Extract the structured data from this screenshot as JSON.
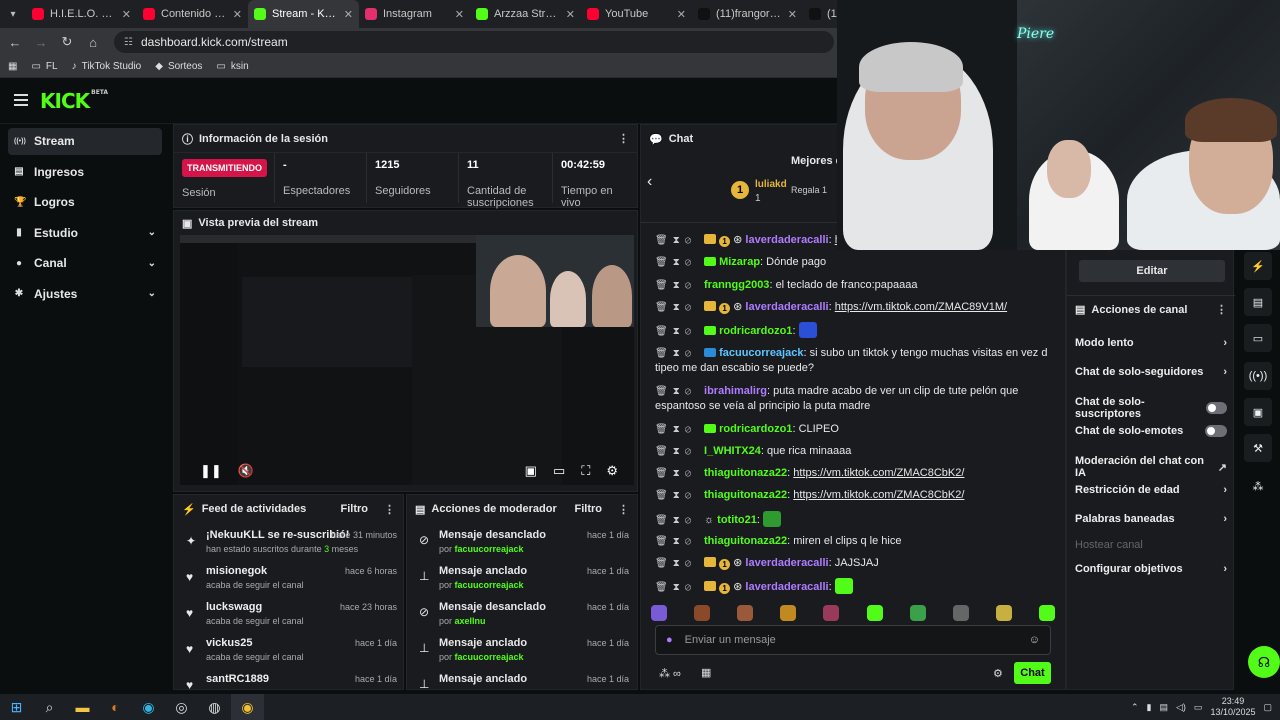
{
  "browser": {
    "tabs": [
      {
        "title": "H.I.E.L.O. - Yo",
        "color": "#ff0033",
        "active": false
      },
      {
        "title": "Contenido del can",
        "color": "#ff0033",
        "active": false
      },
      {
        "title": "Stream - Kick Das",
        "color": "#53fc18",
        "active": true
      },
      {
        "title": "Instagram",
        "color": "#e1306c",
        "active": false
      },
      {
        "title": "Arzzaa Stream - K",
        "color": "#53fc18",
        "active": false
      },
      {
        "title": "YouTube",
        "color": "#ff0033",
        "active": false
      },
      {
        "title": "(11)frangorini (@",
        "color": "#111111",
        "active": false
      },
      {
        "title": "(11",
        "color": "#111111",
        "active": false
      }
    ],
    "url": "dashboard.kick.com/stream",
    "bookmarks": [
      "FL",
      "TikTok Studio",
      "Sorteos",
      "ksin"
    ]
  },
  "header": {
    "logo": "KICK",
    "logo_tag": "BETA"
  },
  "sidebar": {
    "items": [
      {
        "label": "Stream",
        "icon": "live-icon",
        "glyph": "((•))",
        "active": true,
        "chevron": false
      },
      {
        "label": "Ingresos",
        "icon": "list-icon",
        "glyph": "▤",
        "active": false,
        "chevron": false
      },
      {
        "label": "Logros",
        "icon": "trophy-icon",
        "glyph": "🏆",
        "active": false,
        "chevron": false
      },
      {
        "label": "Estudio",
        "icon": "book-icon",
        "glyph": "▮",
        "active": false,
        "chevron": true
      },
      {
        "label": "Canal",
        "icon": "user-icon",
        "glyph": "●",
        "active": false,
        "chevron": true
      },
      {
        "label": "Ajustes",
        "icon": "gear-icon",
        "glyph": "✱",
        "active": false,
        "chevron": true
      }
    ]
  },
  "session": {
    "title": "Información de la sesión",
    "live_badge": "TRANSMITIENDO",
    "live_label": "Sesión",
    "stats": [
      {
        "value": "-",
        "label": "Espectadores"
      },
      {
        "value": "1215",
        "label": "Seguidores"
      },
      {
        "value": "11",
        "label": "Cantidad de suscripciones"
      },
      {
        "value": "00:42:59",
        "label": "Tiempo en vivo"
      }
    ]
  },
  "preview": {
    "title": "Vista previa del stream"
  },
  "feed": {
    "title": "Feed de actividades",
    "filter": "Filtro",
    "items": [
      {
        "name": "¡NekuuKLL se re-suscribió!",
        "sub_pre": "han estado suscritos durante ",
        "sub_num": "3",
        "sub_post": " meses",
        "time": "hace 31 minutos",
        "icon": "sparkle-icon",
        "glyph": "✦"
      },
      {
        "name": "misionegok",
        "sub_pre": "acaba de seguir el canal",
        "sub_num": "",
        "sub_post": "",
        "time": "hace 6 horas",
        "icon": "heart-icon",
        "glyph": "♥"
      },
      {
        "name": "luckswagg",
        "sub_pre": "acaba de seguir el canal",
        "sub_num": "",
        "sub_post": "",
        "time": "hace 23 horas",
        "icon": "heart-icon",
        "glyph": "♥"
      },
      {
        "name": "vickus25",
        "sub_pre": "acaba de seguir el canal",
        "sub_num": "",
        "sub_post": "",
        "time": "hace 1 día",
        "icon": "heart-icon",
        "glyph": "♥"
      },
      {
        "name": "santRC1889",
        "sub_pre": "",
        "sub_num": "",
        "sub_post": "",
        "time": "hace 1 día",
        "icon": "heart-icon",
        "glyph": "♥"
      }
    ]
  },
  "modactions": {
    "title": "Acciones de moderador",
    "filter": "Filtro",
    "items": [
      {
        "action": "Mensaje desanclado",
        "by": "por ",
        "user": "facuucorreajack",
        "time": "hace 1 día",
        "icon": "unpin-icon",
        "glyph": "⊘"
      },
      {
        "action": "Mensaje anclado",
        "by": "por ",
        "user": "facuucorreajack",
        "time": "hace 1 día",
        "icon": "pin-icon",
        "glyph": "⊥"
      },
      {
        "action": "Mensaje desanclado",
        "by": "por ",
        "user": "axellnu",
        "time": "hace 1 día",
        "icon": "unpin-icon",
        "glyph": "⊘"
      },
      {
        "action": "Mensaje anclado",
        "by": "por ",
        "user": "facuucorreajack",
        "time": "hace 1 día",
        "icon": "pin-icon",
        "glyph": "⊥"
      },
      {
        "action": "Mensaje anclado",
        "by": "",
        "user": "",
        "time": "hace 1 día",
        "icon": "pin-icon",
        "glyph": "⊥"
      }
    ]
  },
  "chat": {
    "title": "Chat",
    "top_title": "Mejores d",
    "top_user": "luliakd",
    "top_count": "1",
    "top_gift": "Regala 1",
    "input_placeholder": "Enviar un mensaje",
    "send": "Chat",
    "messages": [
      {
        "user": "laverdaderacalli",
        "color": "#b07cff",
        "badges": "crown1",
        "text": "",
        "link": "https:",
        "emote": ""
      },
      {
        "user": "Mizarap",
        "color": "#53fc18",
        "badges": "sub",
        "text": "Dónde pago",
        "link": "",
        "emote": ""
      },
      {
        "user": "franngg2003",
        "color": "#53fc18",
        "badges": "",
        "text": "el teclado de franco:papaaaa",
        "link": "",
        "emote": ""
      },
      {
        "user": "laverdaderacalli",
        "color": "#b07cff",
        "badges": "crown1",
        "text": "",
        "link": "https://vm.tiktok.com/ZMAC89V1M/",
        "emote": ""
      },
      {
        "user": "rodricardozo1",
        "color": "#53fc18",
        "badges": "sub",
        "text": "",
        "link": "",
        "emote": "#2b4fd6"
      },
      {
        "user": "facuucorreajack",
        "color": "#5ec6ff",
        "badges": "mod",
        "text": "si subo un tiktok y tengo muchas visitas en vez d tipeo me dan escabio se puede?",
        "link": "",
        "emote": ""
      },
      {
        "user": "ibrahimalirg",
        "color": "#b07cff",
        "badges": "",
        "text": "puta madre acabo de ver un clip de tute pelón que espantoso se veía al principio la puta madre",
        "link": "",
        "emote": ""
      },
      {
        "user": "rodricardozo1",
        "color": "#53fc18",
        "badges": "sub",
        "text": "CLIPEO",
        "link": "",
        "emote": ""
      },
      {
        "user": "I_WHITX24",
        "color": "#53fc18",
        "badges": "",
        "text": "que rica minaaaa",
        "link": "",
        "emote": ""
      },
      {
        "user": "thiaguitonaza22",
        "color": "#53fc18",
        "badges": "",
        "text": "",
        "link": "https://vm.tiktok.com/ZMAC8CbK2/",
        "emote": ""
      },
      {
        "user": "thiaguitonaza22",
        "color": "#53fc18",
        "badges": "",
        "text": "",
        "link": "https://vm.tiktok.com/ZMAC8CbK2/",
        "emote": ""
      },
      {
        "user": "totito21",
        "color": "#53fc18",
        "badges": "bot",
        "text": "",
        "link": "",
        "emote": "#2f9a2f"
      },
      {
        "user": "thiaguitonaza22",
        "color": "#53fc18",
        "badges": "",
        "text": "miren el clips q le hice",
        "link": "",
        "emote": ""
      },
      {
        "user": "laverdaderacalli",
        "color": "#b07cff",
        "badges": "crown1",
        "text": "JAJSJAJ",
        "link": "",
        "emote": ""
      },
      {
        "user": "laverdaderacalli",
        "color": "#b07cff",
        "badges": "crown1",
        "text": "",
        "link": "",
        "emote": "#53fc18"
      }
    ]
  },
  "channel_actions": {
    "edit": "Editar",
    "title": "Acciones de canal",
    "items": [
      {
        "label": "Modo lento",
        "kind": "chevron"
      },
      {
        "label": "Chat de solo-seguidores",
        "kind": "chevron"
      },
      {
        "label": "Chat de solo-suscriptores",
        "kind": "toggle"
      },
      {
        "label": "Chat de solo-emotes",
        "kind": "toggle"
      },
      {
        "label": "Moderación del chat con IA",
        "kind": "external"
      },
      {
        "label": "Restricción de edad",
        "kind": "chevron"
      },
      {
        "label": "Palabras baneadas",
        "kind": "chevron"
      },
      {
        "label": "Hostear canal",
        "kind": "disabled"
      },
      {
        "label": "Configurar objetivos",
        "kind": "chevron"
      }
    ]
  },
  "webcam": {
    "sign": "Piere"
  },
  "taskbar": {
    "time": "23:49",
    "date": "13/10/2025"
  },
  "colors": {
    "accent": "#53fc18",
    "live": "#d5154a",
    "panel": "#191b1f",
    "bg": "#0b0e0f"
  }
}
